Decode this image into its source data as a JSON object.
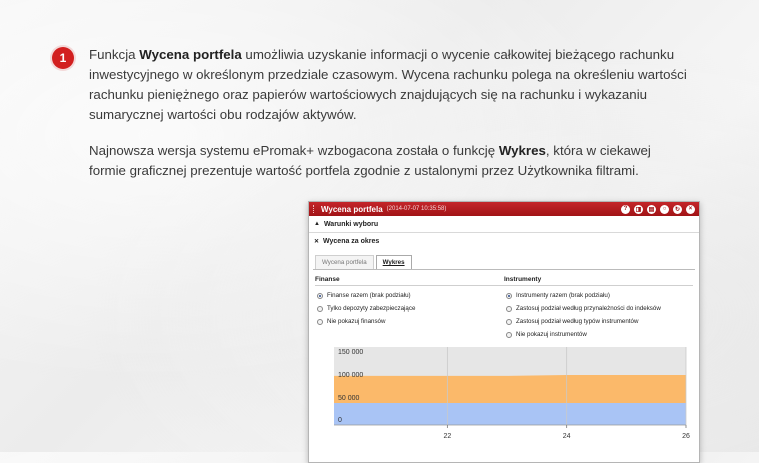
{
  "badge": "1",
  "intro": {
    "prefix": "Funkcja ",
    "bold": "Wycena portfela",
    "rest": " umożliwia uzyskanie informacji o wycenie całkowitej bieżącego rachunku inwestycyjnego w określonym przedziale czasowym. Wycena rachunku polega na określeniu wartości rachunku pieniężnego oraz papierów wartościowych znajdujących się na rachunku i wykazaniu sumarycznej wartości obu rodzajów aktywów."
  },
  "second": {
    "prefix": "Najnowsza wersja systemu ePromak+ wzbogacona została o funkcję ",
    "bold": "Wykres",
    "rest": ", która w ciekawej formie graficznej prezentuje wartość portfela zgodnie z ustalonymi przez Użytkownika filtrami."
  },
  "window": {
    "title": "Wycena portfela",
    "date": "(2014-07-07 10:35:58)",
    "icons": [
      "?",
      "◨",
      "▤",
      "○",
      "↻",
      "×"
    ],
    "section1": "Warunki wyboru",
    "section2": "Wycena za okres",
    "tabs": [
      "Wycena portfela",
      "Wykres"
    ],
    "finanse": {
      "title": "Finanse",
      "options": [
        "Finanse razem (brak podziału)",
        "Tylko depozyty zabezpieczające",
        "Nie pokazuj finansów"
      ],
      "selected": 0
    },
    "instrumenty": {
      "title": "Instrumenty",
      "options": [
        "Instrumenty razem (brak podziału)",
        "Zastosuj podział według przynależności do indeksów",
        "Zastosuj podział według typów instrumentów",
        "Nie pokazuj instrumentów"
      ],
      "selected": 0
    }
  },
  "chart_data": {
    "type": "area",
    "y_ticks": [
      "150 000",
      "100 000",
      "50 000",
      "0"
    ],
    "x_ticks": [
      "22",
      "24",
      "26"
    ],
    "ylim": [
      0,
      170000
    ],
    "x": [
      20.1,
      22,
      23,
      24,
      26
    ],
    "series": [
      {
        "values": [
          48000,
          48000,
          48000,
          48000,
          48000
        ],
        "color": "#a9c4f5"
      },
      {
        "values": [
          107000,
          107000,
          107000,
          109000,
          109000
        ],
        "color": "#fbb96a"
      }
    ],
    "colors": {
      "bg": "#e6e6e6",
      "blue": "#a9c4f5",
      "orange": "#fbb96a"
    }
  }
}
